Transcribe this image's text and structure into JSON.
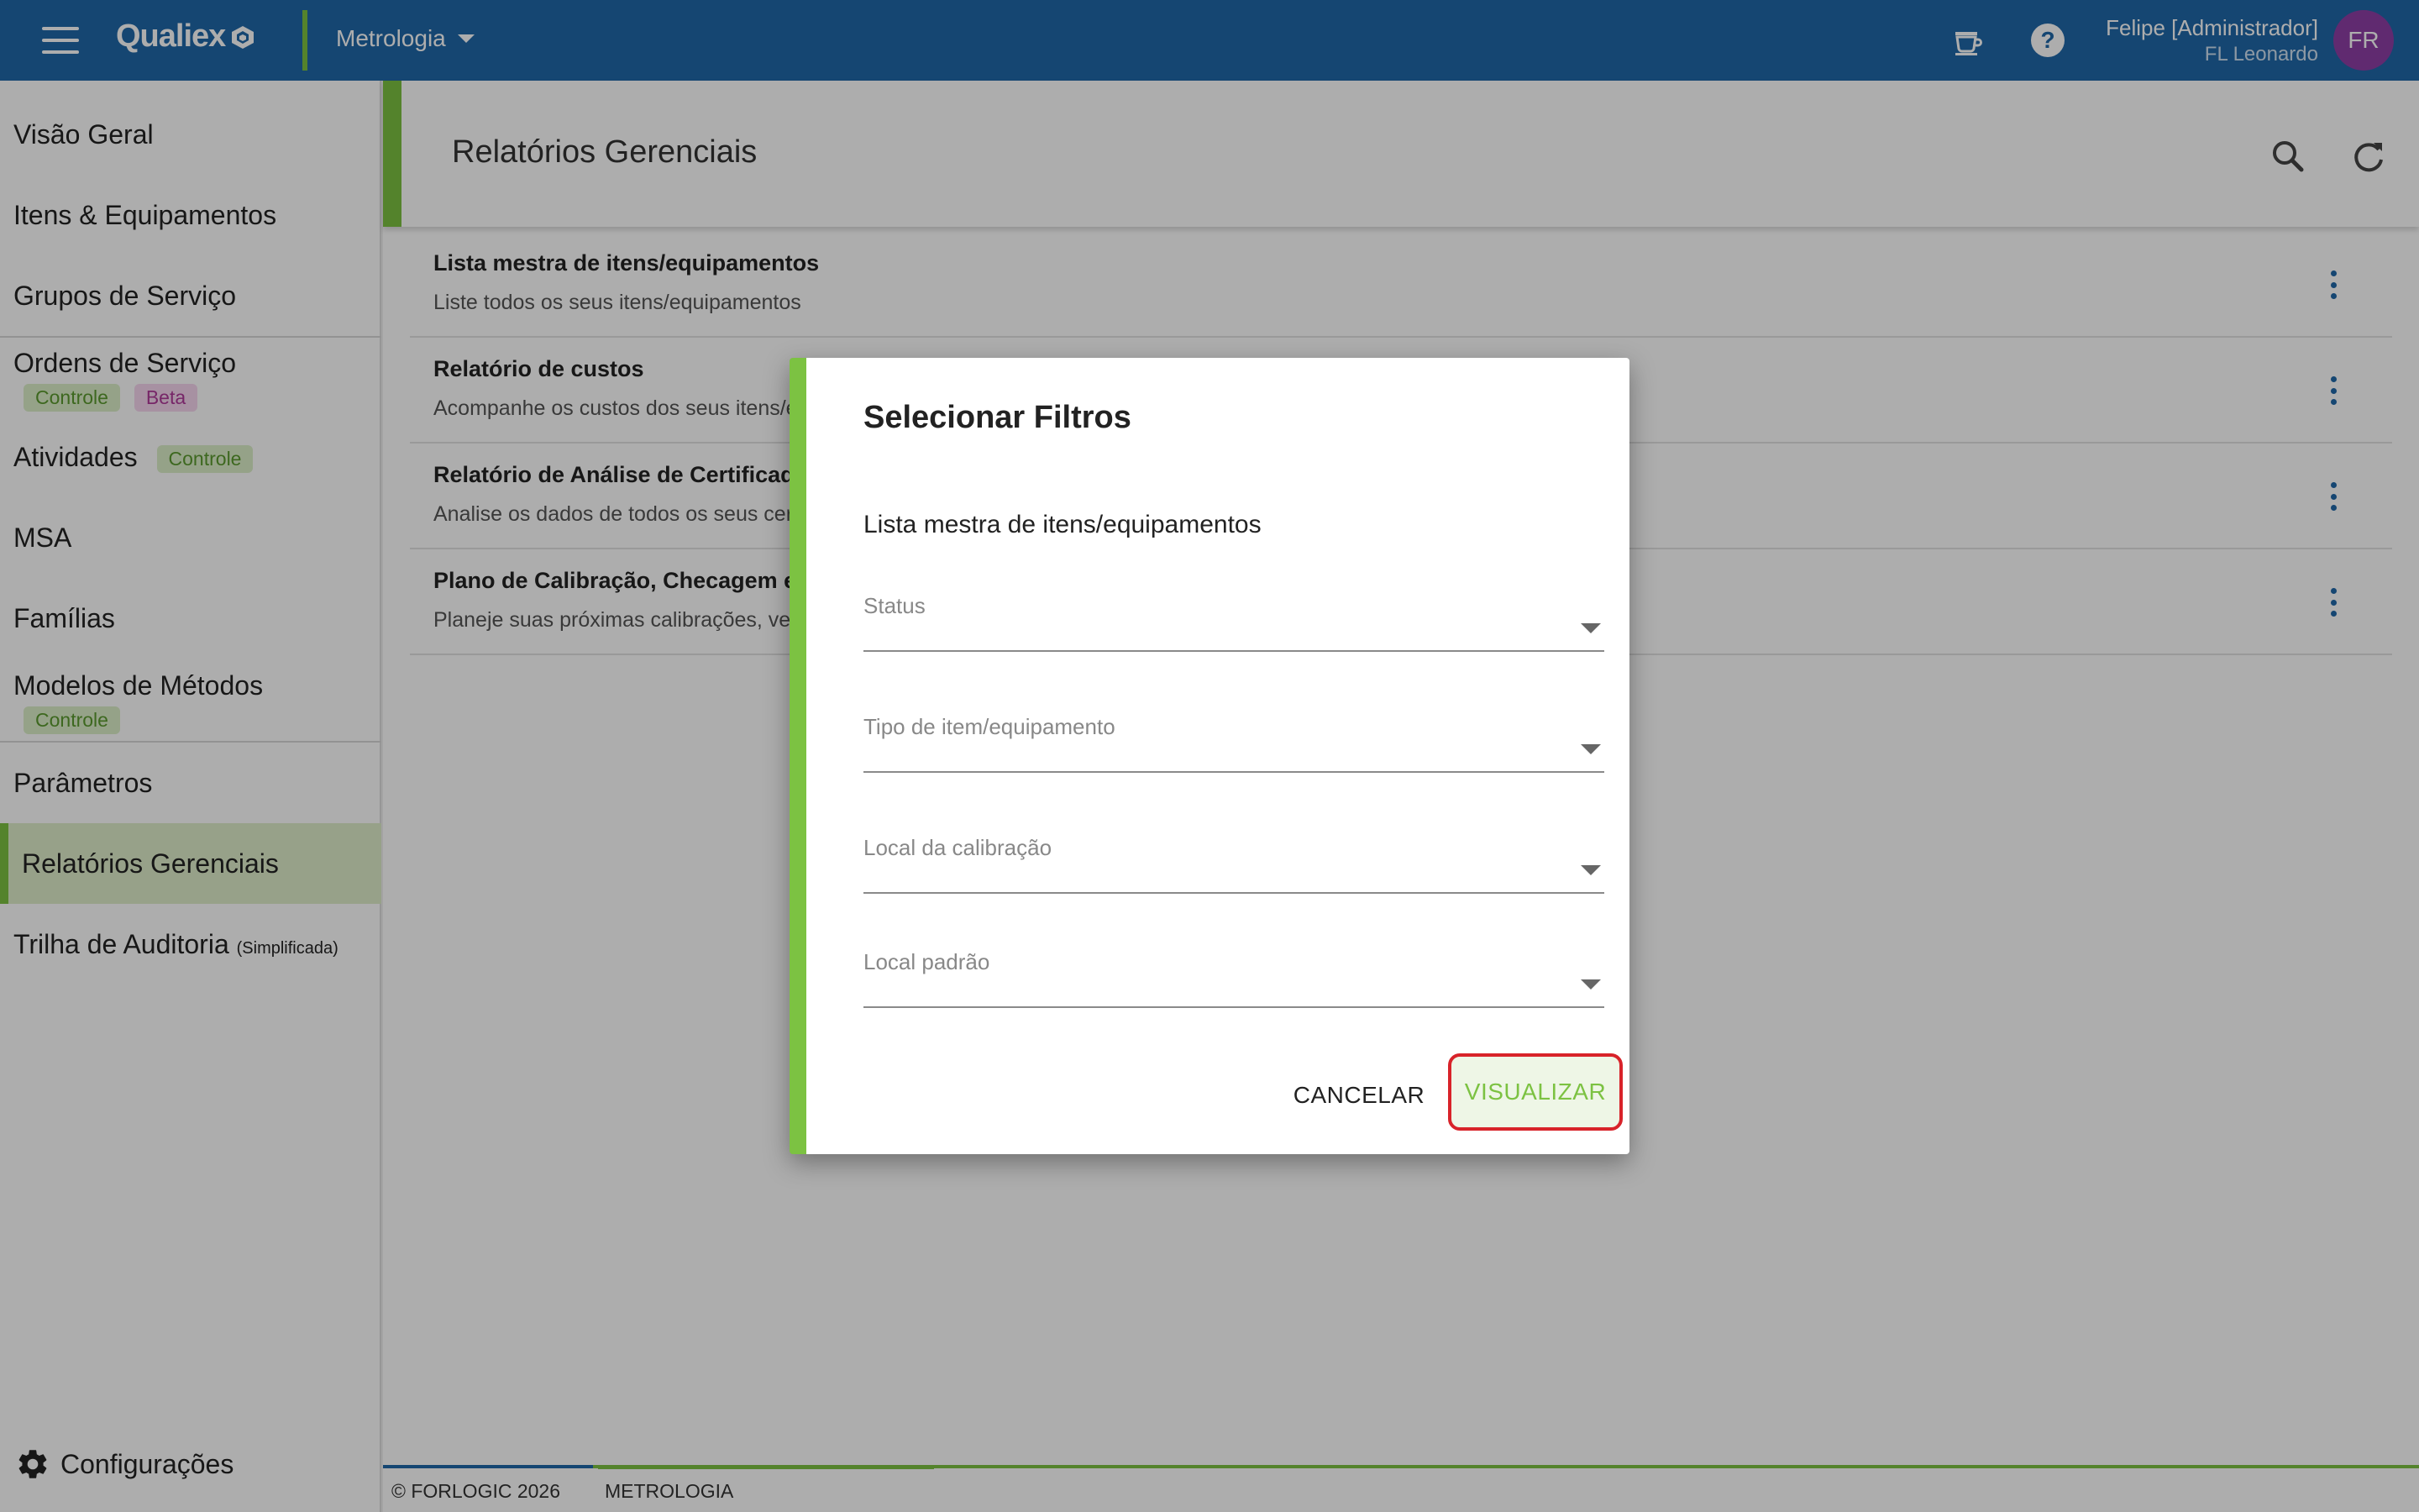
{
  "topbar": {
    "logo_text": "Qualiex",
    "module": "Metrologia",
    "user_name": "Felipe [Administrador]",
    "user_org": "FL Leonardo",
    "avatar_initials": "FR",
    "colors": {
      "bar": "#1f67a8",
      "accent": "#7cc242",
      "avatar": "#8e3fa6"
    }
  },
  "sidebar": {
    "items": [
      {
        "label": "Visão Geral"
      },
      {
        "label": "Itens & Equipamentos"
      },
      {
        "label": "Grupos de Serviço"
      },
      {
        "label": "Ordens de Serviço",
        "badges": [
          "Controle",
          "Beta"
        ]
      },
      {
        "label": "Atividades",
        "badges": [
          "Controle"
        ]
      },
      {
        "label": "MSA"
      },
      {
        "label": "Famílias"
      },
      {
        "label": "Modelos de Métodos",
        "badges": [
          "Controle"
        ]
      },
      {
        "label": "Parâmetros"
      },
      {
        "label": "Relatórios Gerenciais",
        "active": true
      },
      {
        "label": "Trilha de Auditoria",
        "note": "(Simplificada)"
      }
    ],
    "settings_label": "Configurações"
  },
  "main": {
    "title": "Relatórios Gerenciais",
    "reports": [
      {
        "title": "Lista mestra de itens/equipamentos",
        "desc": "Liste todos os seus itens/equipamentos"
      },
      {
        "title": "Relatório de custos",
        "desc": "Acompanhe os custos dos seus itens/e"
      },
      {
        "title": "Relatório de Análise de Certificad",
        "desc": "Analise os dados de todos os seus cert"
      },
      {
        "title": "Plano de Calibração, Checagem e",
        "desc": "Planeje suas próximas calibrações, veri"
      }
    ]
  },
  "footer": {
    "copyright": "© FORLOGIC 2026",
    "module": "METROLOGIA"
  },
  "dialog": {
    "title": "Selecionar Filtros",
    "subtitle": "Lista mestra de itens/equipamentos",
    "fields": [
      {
        "label": "Status"
      },
      {
        "label": "Tipo de item/equipamento"
      },
      {
        "label": "Local da calibração"
      },
      {
        "label": "Local padrão"
      }
    ],
    "cancel_label": "CANCELAR",
    "view_label": "VISUALIZAR"
  }
}
